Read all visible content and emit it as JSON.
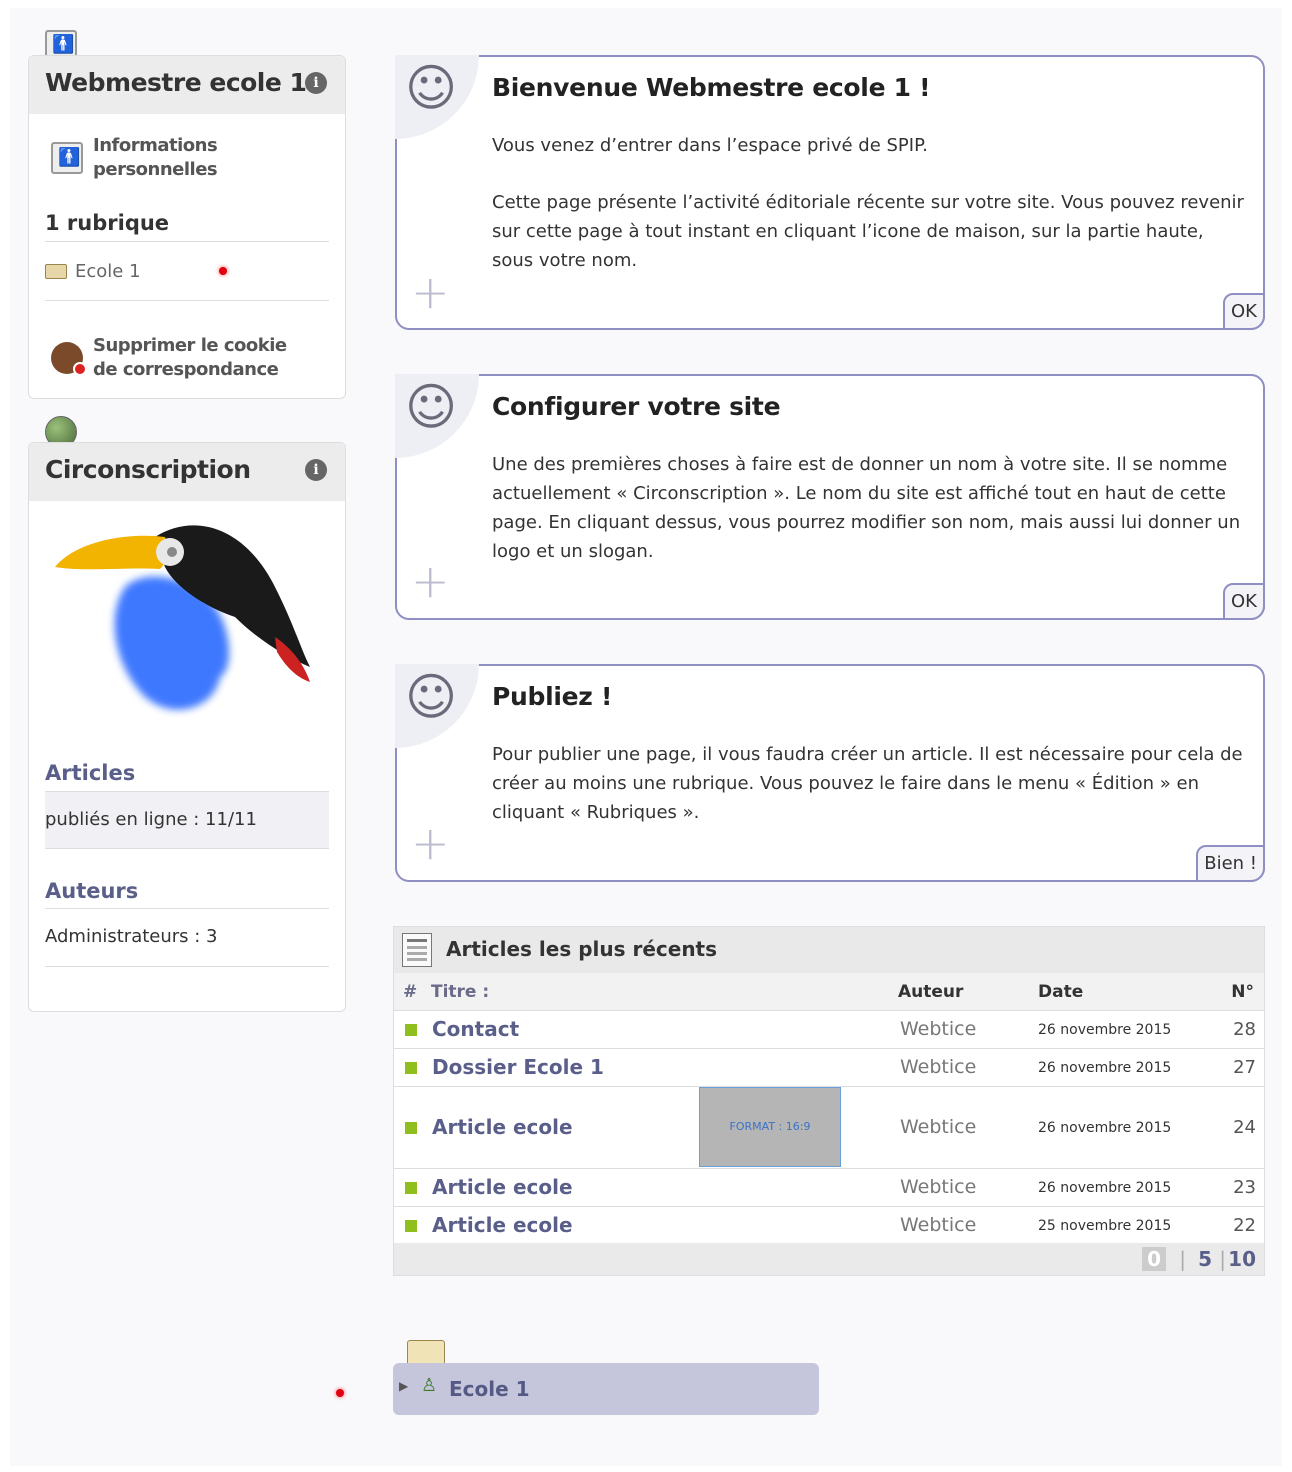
{
  "user_box": {
    "title": "Webmestre ecole 1",
    "info_label": "Informations personnelles",
    "rubriques_title": "1 rubrique",
    "rubrique_item": "Ecole 1",
    "cookie_label": "Supprimer le cookie de correspondance"
  },
  "site_box": {
    "title": "Circonscription",
    "articles_title": "Articles",
    "articles_value": "publiés en ligne : 11/11",
    "auteurs_title": "Auteurs",
    "auteurs_value": "Administrateurs : 3"
  },
  "cards": [
    {
      "title": "Bienvenue Webmestre ecole 1 !",
      "p1": "Vous venez d’entrer dans l’espace privé de SPIP.",
      "p2": "Cette page présente l’activité éditoriale récente sur votre site. Vous pouvez revenir sur cette page à tout instant en cliquant l’icone de maison, sur la partie haute, sous votre nom.",
      "button": "OK"
    },
    {
      "title": "Configurer votre site",
      "p1": "Une des premières choses à faire est de donner un nom à votre site. Il se nomme actuellement « Circonscription ». Le nom du site est affiché tout en haut de cette page. En cliquant dessus, vous pourrez modifier son nom, mais aussi lui donner un logo et un slogan.",
      "button": "OK"
    },
    {
      "title": "Publiez !",
      "p1": "Pour publier une page, il vous faudra créer un article. Il est nécessaire pour cela de créer au moins une rubrique. Vous pouvez le faire dans le menu « Édition » en cliquant « Rubriques ».",
      "button": "Bien !"
    }
  ],
  "recent": {
    "title": "Articles les plus récents",
    "columns": {
      "hash": "#",
      "title": "Titre :",
      "author": "Auteur",
      "date": "Date",
      "num": "N°"
    },
    "rows": [
      {
        "title": "Contact",
        "author": "Webtice",
        "date": "26 novembre 2015",
        "num": "28"
      },
      {
        "title": "Dossier Ecole 1",
        "author": "Webtice",
        "date": "26 novembre 2015",
        "num": "27"
      },
      {
        "title": "Article ecole",
        "author": "Webtice",
        "date": "26 novembre 2015",
        "num": "24",
        "thumb": "FORMAT : 16:9"
      },
      {
        "title": "Article ecole",
        "author": "Webtice",
        "date": "26 novembre 2015",
        "num": "23"
      },
      {
        "title": "Article ecole",
        "author": "Webtice",
        "date": "25 novembre 2015",
        "num": "22"
      }
    ],
    "pager": {
      "current": "0",
      "opt1": "5",
      "opt2": "10",
      "sep": "|"
    }
  },
  "rubrique_bottom": {
    "label": "Ecole 1"
  },
  "colors": {
    "accent": "#5a5f8a",
    "card_border": "#8f8fc4",
    "status_green": "#8fbf1f",
    "rubrique_bg": "#c5c5dc"
  }
}
